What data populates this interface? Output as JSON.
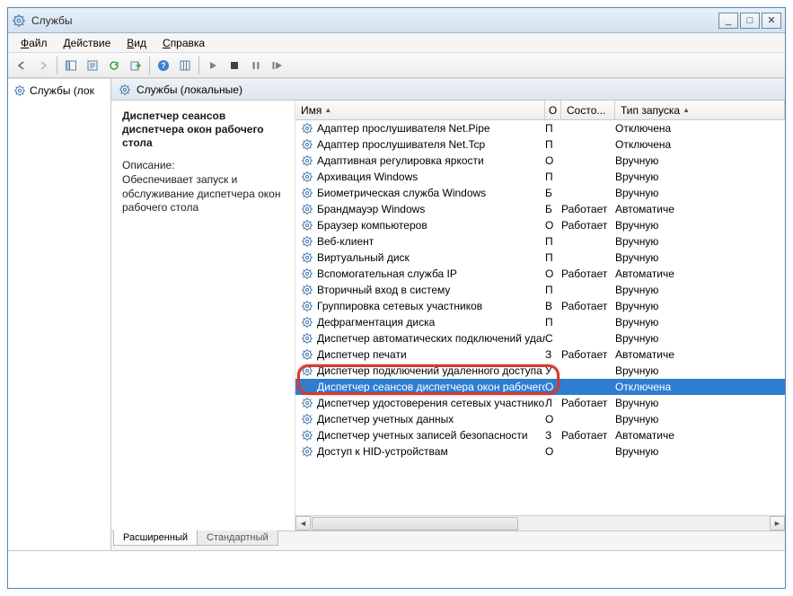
{
  "window": {
    "title": "Службы"
  },
  "menu": {
    "file": "Файл",
    "action": "Действие",
    "view": "Вид",
    "help": "Справка"
  },
  "tree": {
    "root": "Службы (лок"
  },
  "panelTitle": "Службы (локальные)",
  "description": {
    "title": "Диспетчер сеансов диспетчера окон рабочего стола",
    "label": "Описание:",
    "body": "Обеспечивает запуск и обслуживание диспетчера окон рабочего стола"
  },
  "columns": {
    "name": "Имя",
    "desc": "О",
    "state": "Состо...",
    "startup": "Тип запуска"
  },
  "tabs": {
    "extended": "Расширенный",
    "standard": "Стандартный"
  },
  "services": [
    {
      "name": "Адаптер прослушивателя Net.Pipe",
      "d": "П",
      "state": "",
      "startup": "Отключена"
    },
    {
      "name": "Адаптер прослушивателя Net.Tcp",
      "d": "П",
      "state": "",
      "startup": "Отключена"
    },
    {
      "name": "Адаптивная регулировка яркости",
      "d": "О",
      "state": "",
      "startup": "Вручную"
    },
    {
      "name": "Архивация Windows",
      "d": "П",
      "state": "",
      "startup": "Вручную"
    },
    {
      "name": "Биометрическая служба Windows",
      "d": "Б",
      "state": "",
      "startup": "Вручную"
    },
    {
      "name": "Брандмауэр Windows",
      "d": "Б",
      "state": "Работает",
      "startup": "Автоматиче"
    },
    {
      "name": "Браузер компьютеров",
      "d": "О",
      "state": "Работает",
      "startup": "Вручную"
    },
    {
      "name": "Веб-клиент",
      "d": "П",
      "state": "",
      "startup": "Вручную"
    },
    {
      "name": "Виртуальный диск",
      "d": "П",
      "state": "",
      "startup": "Вручную"
    },
    {
      "name": "Вспомогательная служба IP",
      "d": "О",
      "state": "Работает",
      "startup": "Автоматиче"
    },
    {
      "name": "Вторичный вход в систему",
      "d": "П",
      "state": "",
      "startup": "Вручную"
    },
    {
      "name": "Группировка сетевых участников",
      "d": "В",
      "state": "Работает",
      "startup": "Вручную"
    },
    {
      "name": "Дефрагментация диска",
      "d": "П",
      "state": "",
      "startup": "Вручную"
    },
    {
      "name": "Диспетчер автоматических подключений удален...",
      "d": "С",
      "state": "",
      "startup": "Вручную"
    },
    {
      "name": "Диспетчер печати",
      "d": "З",
      "state": "Работает",
      "startup": "Автоматиче"
    },
    {
      "name": "Диспетчер подключений удаленного доступа",
      "d": "У",
      "state": "",
      "startup": "Вручную"
    },
    {
      "name": "Диспетчер сеансов диспетчера окон рабочего стола",
      "d": "О",
      "state": "",
      "startup": "Отключена",
      "selected": true
    },
    {
      "name": "Диспетчер удостоверения сетевых участников",
      "d": "Л",
      "state": "Работает",
      "startup": "Вручную"
    },
    {
      "name": "Диспетчер учетных данных",
      "d": "О",
      "state": "",
      "startup": "Вручную"
    },
    {
      "name": "Диспетчер учетных записей безопасности",
      "d": "З",
      "state": "Работает",
      "startup": "Автоматиче"
    },
    {
      "name": "Доступ к HID-устройствам",
      "d": "О",
      "state": "",
      "startup": "Вручную"
    }
  ]
}
